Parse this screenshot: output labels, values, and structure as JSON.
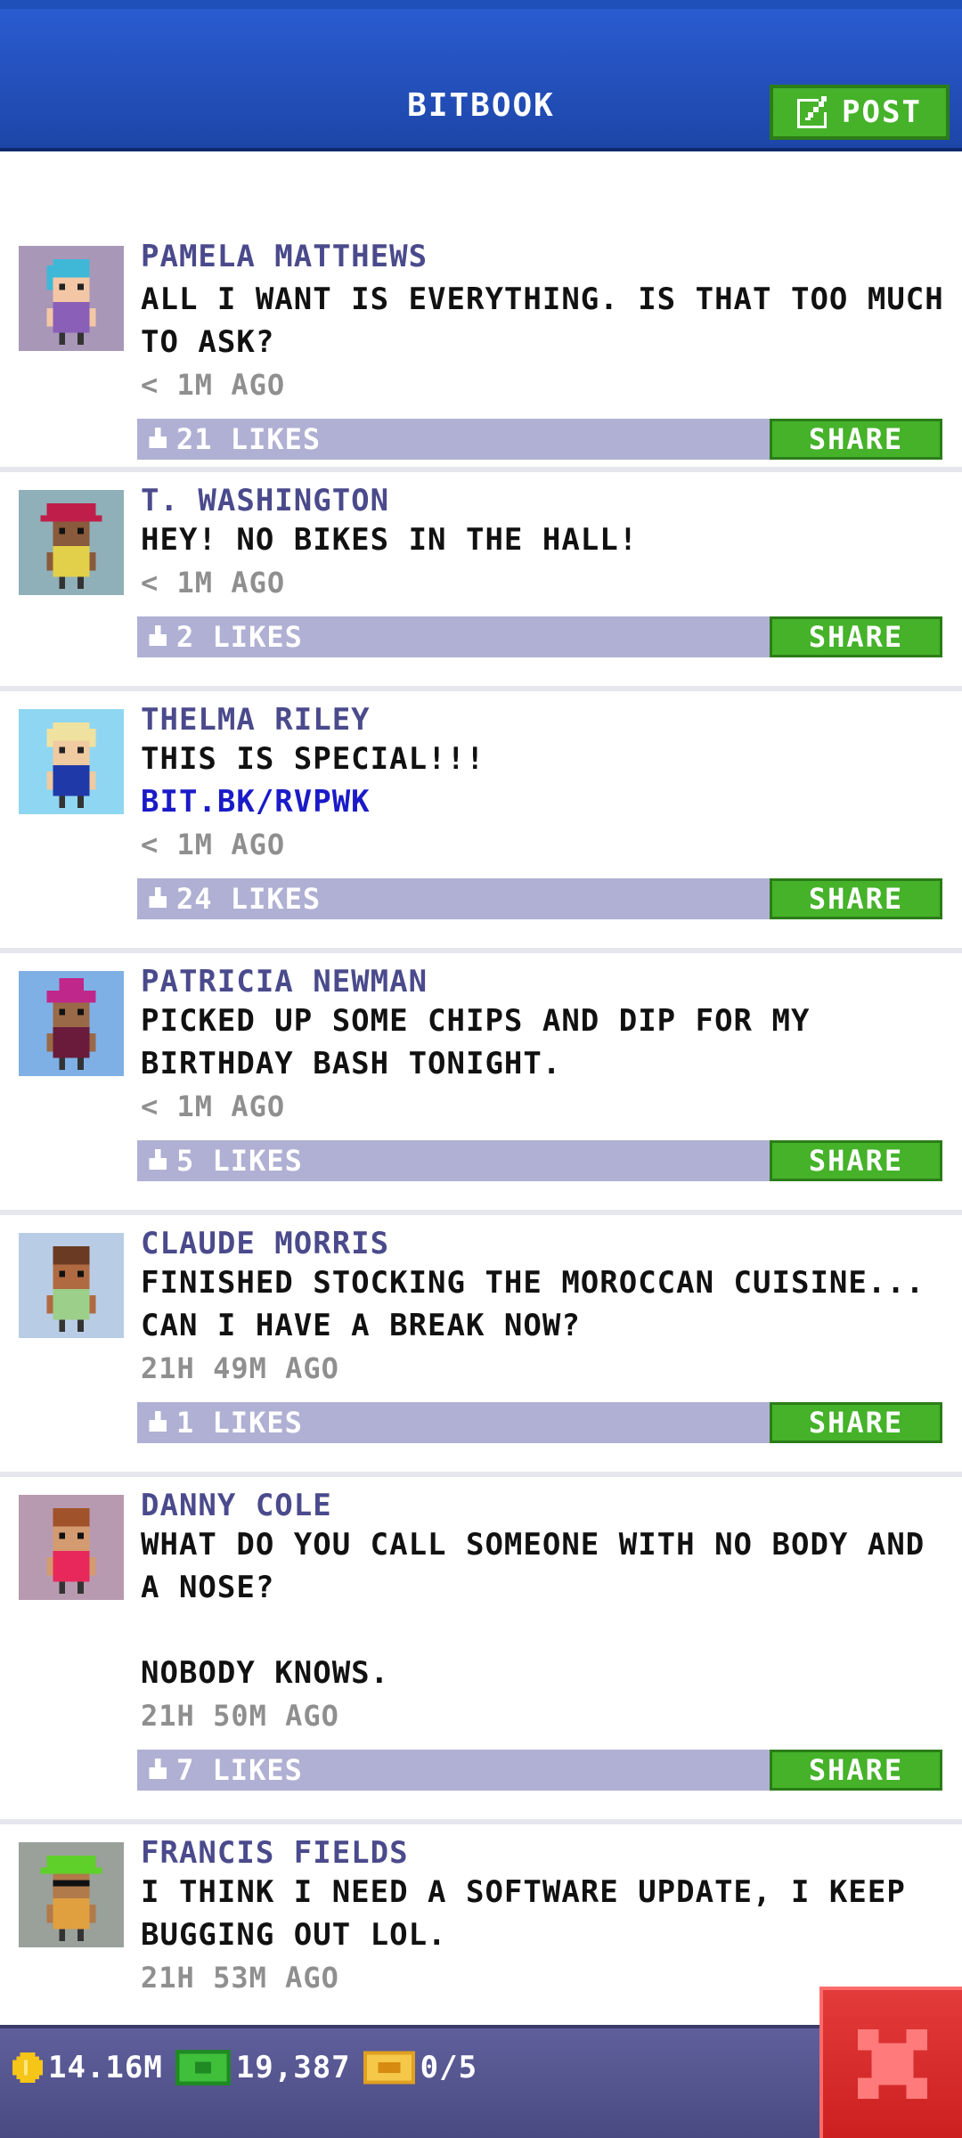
{
  "header": {
    "title": "BITBOOK",
    "post_label": "POST"
  },
  "colors": {
    "accent": "#45b22a",
    "header": "#2a5bd0",
    "bar": "#b0b0d4",
    "close": "#d92b2b",
    "author": "#4a4a8c",
    "link": "#1a1ac8"
  },
  "posts": [
    {
      "author": "PAMELA MATTHEWS",
      "text": "ALL I WANT IS EVERYTHING. IS THAT TOO MUCH TO ASK?",
      "link": "",
      "time": "< 1M AGO",
      "likes": "21 LIKES",
      "share": "SHARE"
    },
    {
      "author": "T. WASHINGTON",
      "text": "HEY! NO BIKES IN THE HALL!",
      "link": "",
      "time": "< 1M AGO",
      "likes": "2 LIKES",
      "share": "SHARE"
    },
    {
      "author": "THELMA RILEY",
      "text": "THIS IS SPECIAL!!!",
      "link": "BIT.BK/RVPWK",
      "time": "< 1M AGO",
      "likes": "24 LIKES",
      "share": "SHARE"
    },
    {
      "author": "PATRICIA NEWMAN",
      "text": "PICKED UP SOME CHIPS AND DIP FOR MY BIRTHDAY BASH TONIGHT.",
      "link": "",
      "time": "< 1M AGO",
      "likes": "5 LIKES",
      "share": "SHARE"
    },
    {
      "author": "CLAUDE MORRIS",
      "text": "FINISHED STOCKING THE MOROCCAN CUISINE... CAN I HAVE A BREAK NOW?",
      "link": "",
      "time": "21H 49M AGO",
      "likes": "1 LIKES",
      "share": "SHARE"
    },
    {
      "author": "DANNY COLE",
      "text": "WHAT DO YOU CALL SOMEONE WITH NO BODY AND A NOSE?\n\nNOBODY KNOWS.",
      "link": "",
      "time": "21H 50M AGO",
      "likes": "7 LIKES",
      "share": "SHARE"
    },
    {
      "author": "FRANCIS FIELDS",
      "text": "I THINK I NEED A SOFTWARE UPDATE, I KEEP BUGGING OUT LOL.",
      "link": "",
      "time": "21H 53M AGO",
      "likes": "",
      "share": ""
    }
  ],
  "footer": {
    "coins": "14.16M",
    "bux": "19,387",
    "tickets": "0/5"
  },
  "icons": {
    "post": "edit-icon",
    "like": "thumbs-up-icon",
    "coins": "coin-icon",
    "bux": "cash-icon",
    "tickets": "ticket-icon",
    "close": "close-icon"
  }
}
